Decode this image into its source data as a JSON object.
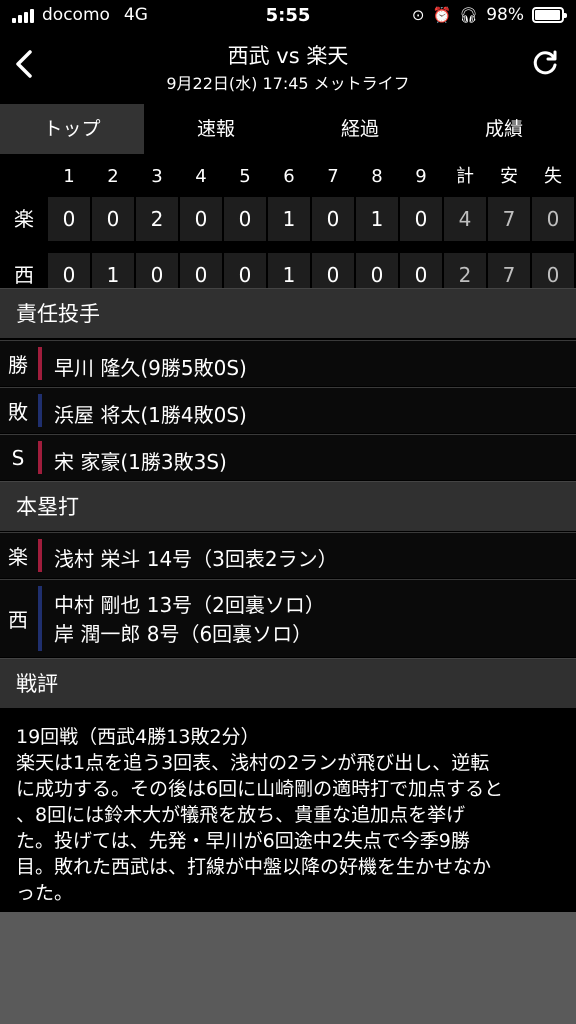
{
  "status_bar": {
    "carrier": "docomo",
    "network": "4G",
    "time": "5:55",
    "battery": "98%",
    "battery_level": 0.98
  },
  "header": {
    "title": "西武 vs 楽天",
    "subtitle": "9月22日(水) 17:45 メットライフ"
  },
  "tabs": [
    {
      "label": "トップ",
      "active": true
    },
    {
      "label": "速報",
      "active": false
    },
    {
      "label": "経過",
      "active": false
    },
    {
      "label": "成績",
      "active": false
    }
  ],
  "scoreboard": {
    "columns": [
      "1",
      "2",
      "3",
      "4",
      "5",
      "6",
      "7",
      "8",
      "9",
      "計",
      "安",
      "失"
    ],
    "teams": [
      {
        "name": "楽",
        "scores": [
          "0",
          "0",
          "2",
          "0",
          "0",
          "1",
          "0",
          "1",
          "0",
          "4",
          "7",
          "0"
        ],
        "color": "#a01d3c"
      },
      {
        "name": "西",
        "scores": [
          "0",
          "1",
          "0",
          "0",
          "0",
          "1",
          "0",
          "0",
          "0",
          "2",
          "7",
          "0"
        ],
        "color": "#1f2f6e"
      }
    ]
  },
  "pitchers": {
    "heading": "責任投手",
    "rows": [
      {
        "mark": "勝",
        "text": "早川 隆久(9勝5敗0S)"
      },
      {
        "mark": "敗",
        "text": "浜屋 将太(1勝4敗0S)"
      },
      {
        "mark": "S",
        "text": "宋 家豪(1勝3敗3S)"
      }
    ]
  },
  "homeruns": {
    "heading": "本塁打",
    "rows": [
      {
        "mark": "楽",
        "lines": [
          "浅村 栄斗 14号（3回表2ラン）"
        ]
      },
      {
        "mark": "西",
        "lines": [
          "中村 剛也 13号（2回裏ソロ）",
          "岸 潤一郎 8号（6回裏ソロ）"
        ]
      }
    ]
  },
  "review": {
    "heading": "戦評",
    "lines": [
      "19回戦（西武4勝13敗2分）",
      "楽天は1点を追う3回表、浅村の2ランが飛び出し、逆転",
      "に成功する。その後は6回に山崎剛の適時打で加点すると",
      "、8回には鈴木大が犠飛を放ち、貴重な追加点を挙げ",
      "た。投げては、先発・早川が6回途中2失点で今季9勝",
      "目。敗れた西武は、打線が中盤以降の好機を生かせなか",
      "った。"
    ]
  },
  "icons": {
    "back": "chevron-left-icon",
    "refresh": "refresh-icon"
  }
}
